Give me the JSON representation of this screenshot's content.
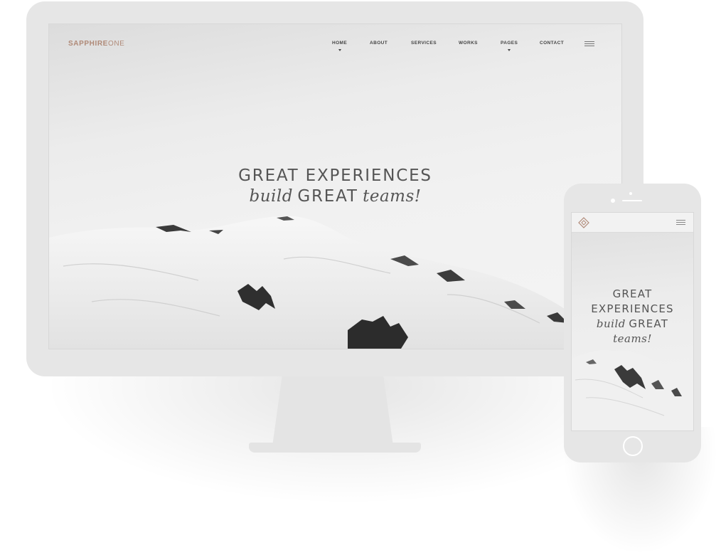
{
  "desktop": {
    "logo": {
      "bold": "SAPPHIRE",
      "thin": "ONE"
    },
    "nav": [
      {
        "label": "HOME",
        "dropdown": true
      },
      {
        "label": "ABOUT",
        "dropdown": false
      },
      {
        "label": "SERVICES",
        "dropdown": false
      },
      {
        "label": "WORKS",
        "dropdown": false
      },
      {
        "label": "PAGES",
        "dropdown": true
      },
      {
        "label": "CONTACT",
        "dropdown": false
      }
    ],
    "menu_icon": "hamburger-icon",
    "hero": {
      "line1": "GREAT EXPERIENCES",
      "line2_a": "build",
      "line2_b": "GREAT",
      "line2_c": "teams!"
    }
  },
  "mobile": {
    "logo_icon": "diamond-logo-icon",
    "menu_icon": "hamburger-icon",
    "hero": {
      "line1": "GREAT",
      "line2": "EXPERIENCES",
      "line3_a": "build",
      "line3_b": "GREAT",
      "line4": "teams!"
    }
  },
  "colors": {
    "device_frame": "#e6e6e6",
    "logo_accent": "#b08a78",
    "hero_text": "#555555",
    "nav_text": "#444444"
  }
}
